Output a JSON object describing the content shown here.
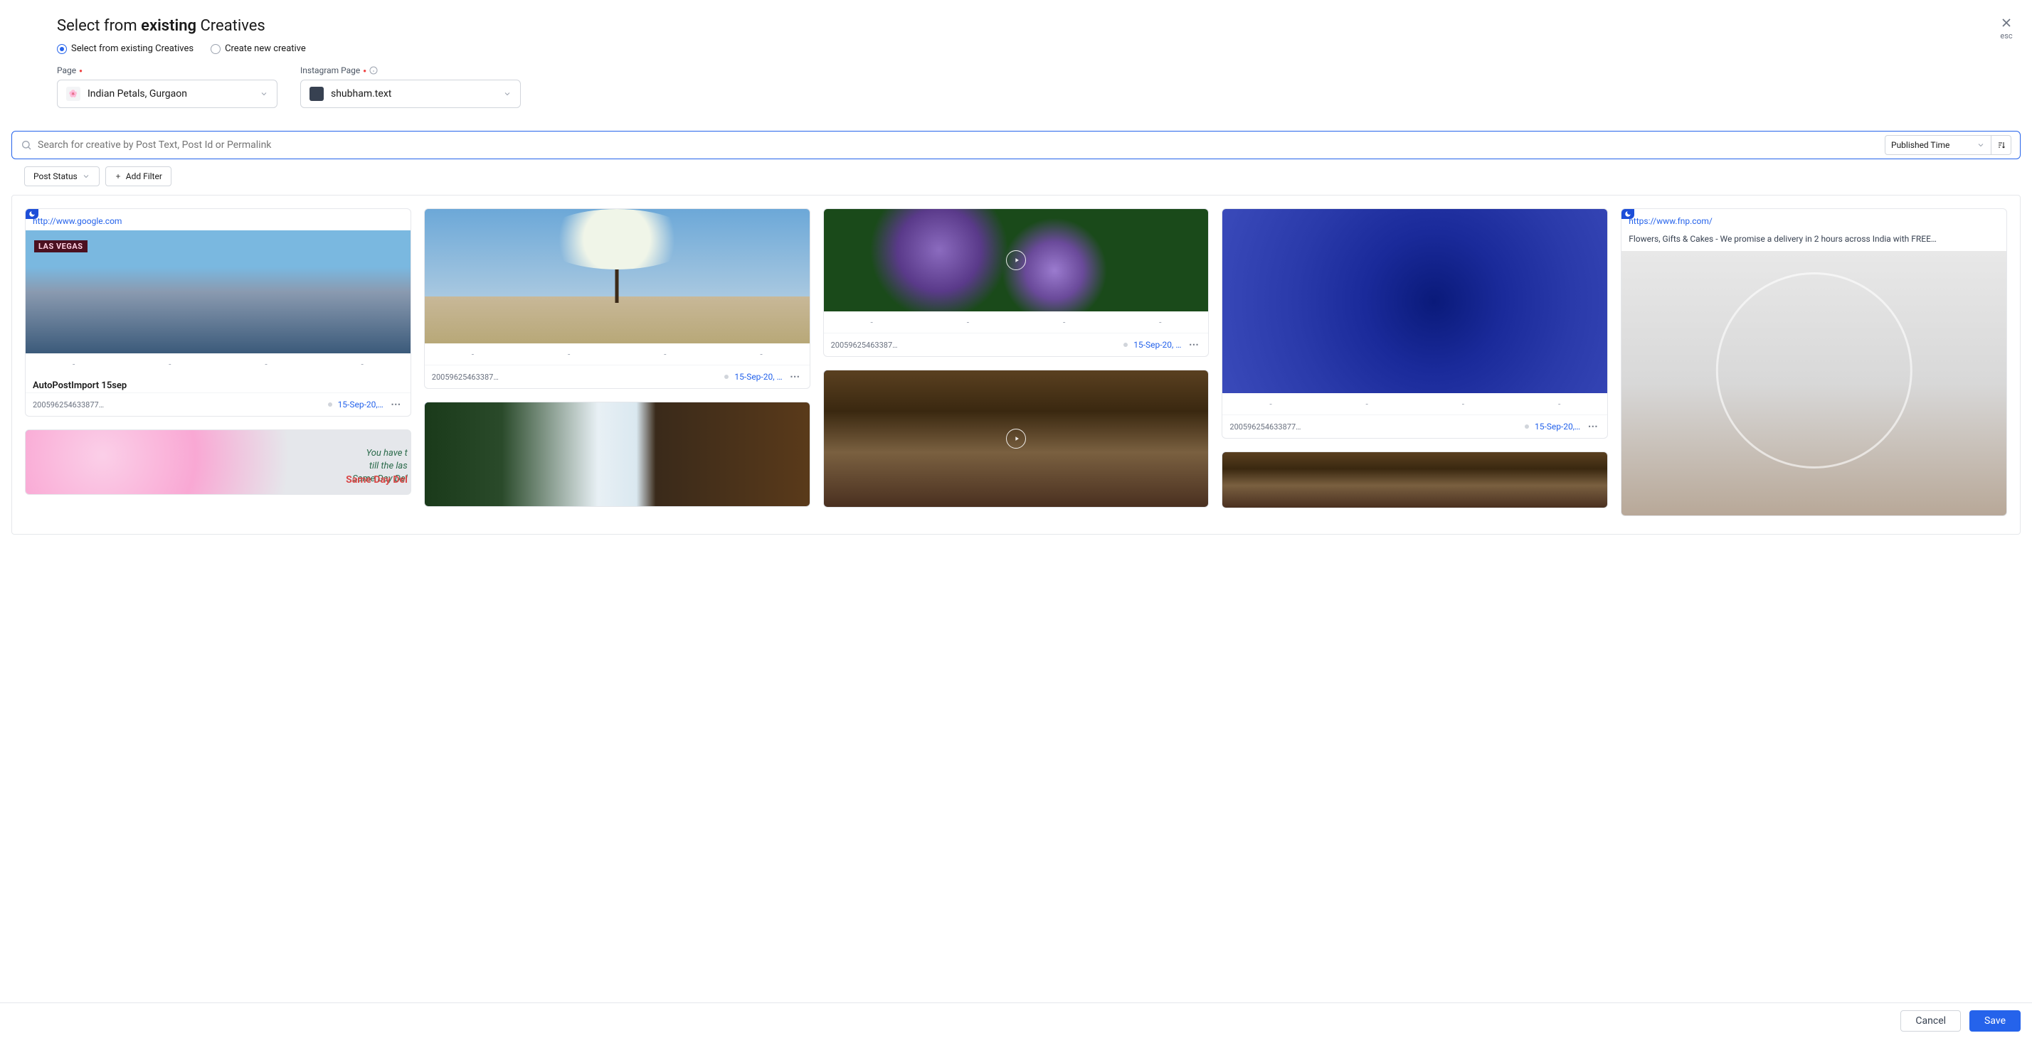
{
  "header": {
    "title_prefix": "Select from ",
    "title_bold": "existing",
    "title_suffix": " Creatives",
    "close_label": "esc"
  },
  "radios": {
    "existing": "Select from existing Creatives",
    "create": "Create new creative"
  },
  "page_field": {
    "label": "Page",
    "value": "Indian Petals, Gurgaon"
  },
  "instagram_field": {
    "label": "Instagram Page",
    "value": "shubham.text"
  },
  "search": {
    "placeholder": "Search for creative by Post Text, Post Id or Permalink"
  },
  "sort": {
    "value": "Published Time"
  },
  "filters": {
    "post_status": "Post Status",
    "add_filter": "Add Filter"
  },
  "cards": {
    "c1": {
      "link": "http://www.google.com",
      "title": "AutoPostImport 15sep",
      "id": "200596254633877…",
      "date": "15-Sep-20,…"
    },
    "c3": {
      "id": "20059625463387…",
      "date": "15-Sep-20, …"
    },
    "c5": {
      "id": "20059625463387…",
      "date": "15-Sep-20, …"
    },
    "c7": {
      "id": "200596254633877…",
      "date": "15-Sep-20,…"
    },
    "c9": {
      "link": "https://www.fnp.com/",
      "desc": "Flowers, Gifts & Cakes - We promise a delivery in 2 hours across India with FREE…"
    }
  },
  "footer": {
    "cancel": "Cancel",
    "save": "Save"
  }
}
